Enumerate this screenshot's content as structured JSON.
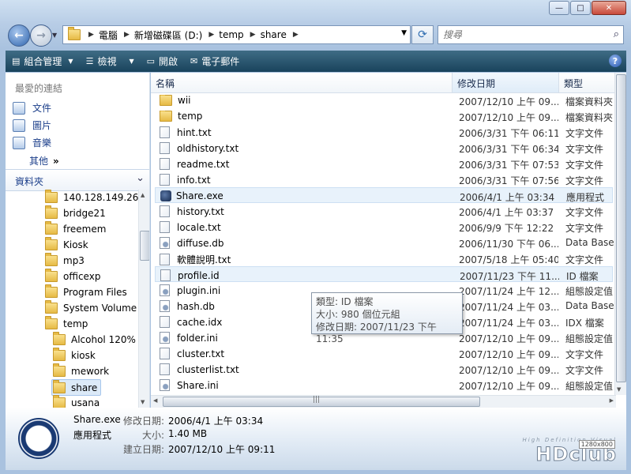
{
  "address": {
    "segments": [
      "電腦",
      "新增磁碟區 (D:)",
      "temp",
      "share"
    ]
  },
  "search": {
    "placeholder": "搜尋"
  },
  "toolbar": {
    "organize": "組合管理",
    "views": "檢視",
    "open": "開啟",
    "email": "電子郵件"
  },
  "left_pane": {
    "favorites_header": "最愛的連結",
    "favorites": [
      "文件",
      "圖片",
      "音樂"
    ],
    "more": "其他",
    "folders_header": "資料夾",
    "tree": [
      {
        "label": "140.128.149.26",
        "indent": 1
      },
      {
        "label": "bridge21",
        "indent": 1
      },
      {
        "label": "freemem",
        "indent": 1
      },
      {
        "label": "Kiosk",
        "indent": 1
      },
      {
        "label": "mp3",
        "indent": 1
      },
      {
        "label": "officexp",
        "indent": 1
      },
      {
        "label": "Program Files",
        "indent": 1
      },
      {
        "label": "System Volume Information",
        "indent": 1
      },
      {
        "label": "temp",
        "indent": 1
      },
      {
        "label": "Alcohol 120%",
        "indent": 2
      },
      {
        "label": "kiosk",
        "indent": 2
      },
      {
        "label": "mework",
        "indent": 2
      },
      {
        "label": "share",
        "indent": 2,
        "selected": true
      },
      {
        "label": "usana",
        "indent": 2
      }
    ]
  },
  "columns": {
    "name": "名稱",
    "modified": "修改日期",
    "type": "類型"
  },
  "files": [
    {
      "name": "wii",
      "date": "2007/12/10 上午 09...",
      "type": "檔案資料夾",
      "icon": "folder"
    },
    {
      "name": "temp",
      "date": "2007/12/10 上午 09...",
      "type": "檔案資料夾",
      "icon": "folder"
    },
    {
      "name": "hint.txt",
      "date": "2006/3/31 下午 06:11",
      "type": "文字文件",
      "icon": "doc"
    },
    {
      "name": "oldhistory.txt",
      "date": "2006/3/31 下午 06:34",
      "type": "文字文件",
      "icon": "doc"
    },
    {
      "name": "readme.txt",
      "date": "2006/3/31 下午 07:53",
      "type": "文字文件",
      "icon": "doc"
    },
    {
      "name": "info.txt",
      "date": "2006/3/31 下午 07:56",
      "type": "文字文件",
      "icon": "doc"
    },
    {
      "name": "Share.exe",
      "date": "2006/4/1 上午 03:34",
      "type": "應用程式",
      "icon": "exe",
      "selected": true
    },
    {
      "name": "history.txt",
      "date": "2006/4/1 上午 03:37",
      "type": "文字文件",
      "icon": "doc"
    },
    {
      "name": "locale.txt",
      "date": "2006/9/9 下午 12:22",
      "type": "文字文件",
      "icon": "doc"
    },
    {
      "name": "diffuse.db",
      "date": "2006/11/30 下午 06...",
      "type": "Data Base",
      "icon": "cfg"
    },
    {
      "name": "軟體說明.txt",
      "date": "2007/5/18 上午 05:40",
      "type": "文字文件",
      "icon": "doc"
    },
    {
      "name": "profile.id",
      "date": "2007/11/23 下午 11...",
      "type": "ID 檔案",
      "icon": "doc",
      "hover": true
    },
    {
      "name": "plugin.ini",
      "date": "2007/11/24 上午 12...",
      "type": "組態設定值",
      "icon": "cfg"
    },
    {
      "name": "hash.db",
      "date": "2007/11/24 上午 03...",
      "type": "Data Base",
      "icon": "cfg"
    },
    {
      "name": "cache.idx",
      "date": "2007/11/24 上午 03...",
      "type": "IDX 檔案",
      "icon": "doc"
    },
    {
      "name": "folder.ini",
      "date": "2007/12/10 上午 09...",
      "type": "組態設定值",
      "icon": "cfg"
    },
    {
      "name": "cluster.txt",
      "date": "2007/12/10 上午 09...",
      "type": "文字文件",
      "icon": "doc"
    },
    {
      "name": "clusterlist.txt",
      "date": "2007/12/10 上午 09...",
      "type": "文字文件",
      "icon": "doc"
    },
    {
      "name": "Share.ini",
      "date": "2007/12/10 上午 09...",
      "type": "組態設定值",
      "icon": "cfg"
    }
  ],
  "tooltip": {
    "type": "類型: ID 檔案",
    "size": "大小: 980 個位元組",
    "modified": "修改日期: 2007/11/23 下午 11:35"
  },
  "details": {
    "name": "Share.exe",
    "type": "應用程式",
    "modified_label": "修改日期:",
    "modified": "2006/4/1 上午 03:34",
    "size_label": "大小:",
    "size": "1.40 MB",
    "created_label": "建立日期:",
    "created": "2007/12/10 上午 09:11"
  },
  "watermark": {
    "small": "High Definition Visual",
    "big": "HDclub",
    "badge": "1280x800"
  }
}
